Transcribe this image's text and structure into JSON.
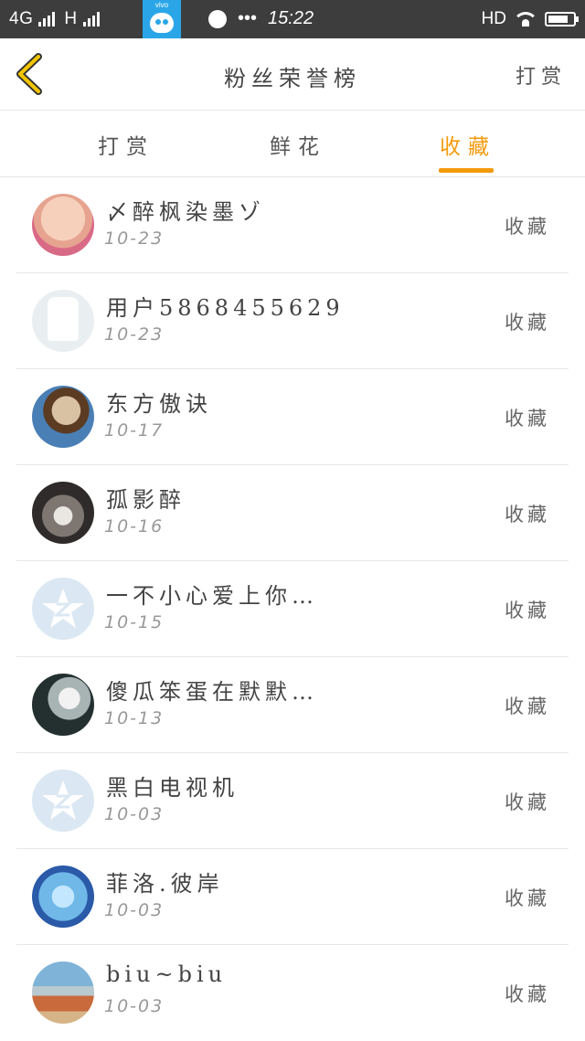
{
  "status_bar": {
    "network": "4G",
    "network2": "H",
    "time": "15:22",
    "hd": "HD",
    "vivo_label": "vivo"
  },
  "header": {
    "title": "粉丝荣誉榜",
    "right_link": "打赏"
  },
  "tabs": [
    {
      "label": "打赏",
      "active": false
    },
    {
      "label": "鲜花",
      "active": false
    },
    {
      "label": "收藏",
      "active": true
    }
  ],
  "accent_color": "#f39a0b",
  "list": [
    {
      "name": "〆醉枫染墨ゾ",
      "date": "10-23",
      "action": "收藏",
      "avatar": "child-photo"
    },
    {
      "name": "用户5868455629",
      "date": "10-23",
      "action": "收藏",
      "avatar": "default-user"
    },
    {
      "name": "东方傲诀",
      "date": "10-17",
      "action": "收藏",
      "avatar": "man-photo"
    },
    {
      "name": "孤影醉",
      "date": "10-16",
      "action": "收藏",
      "avatar": "tunnel-photo"
    },
    {
      "name": "一不小心爱上你…",
      "date": "10-15",
      "action": "收藏",
      "avatar": "qq-default"
    },
    {
      "name": "傻瓜笨蛋在默默…",
      "date": "10-13",
      "action": "收藏",
      "avatar": "dark-photo"
    },
    {
      "name": "黑白电视机",
      "date": "10-03",
      "action": "收藏",
      "avatar": "qq-default"
    },
    {
      "name": "菲洛.彼岸",
      "date": "10-03",
      "action": "收藏",
      "avatar": "anime-photo"
    },
    {
      "name": "biu~biu",
      "date": "10-03",
      "action": "收藏",
      "avatar": "boat-photo"
    }
  ]
}
